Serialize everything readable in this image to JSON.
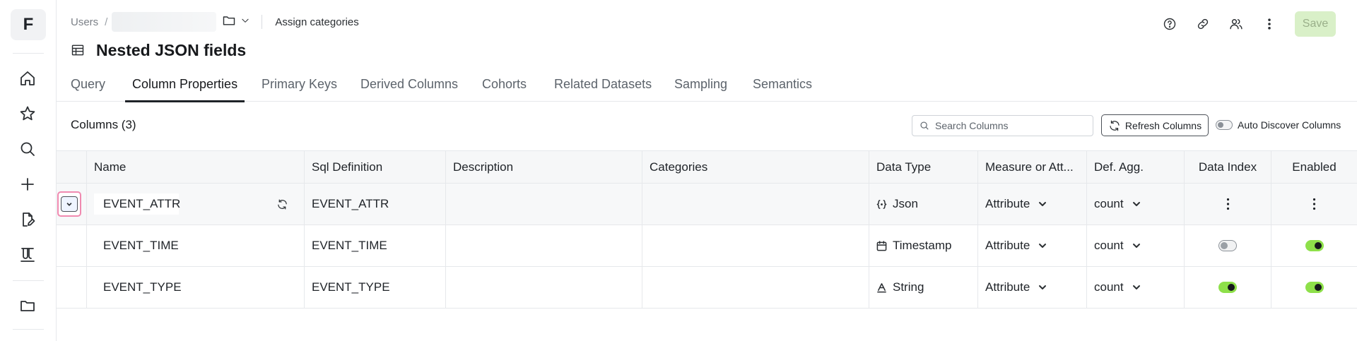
{
  "app": {
    "logo_letter": "F"
  },
  "sidebar": {
    "items": [
      {
        "icon": "home-icon"
      },
      {
        "icon": "star-icon"
      },
      {
        "icon": "search-icon"
      },
      {
        "icon": "plus-icon"
      },
      {
        "icon": "edit-document-icon"
      },
      {
        "icon": "lab-icon"
      },
      {
        "icon": "folder-icon"
      }
    ]
  },
  "breadcrumb": {
    "root": "Users",
    "separator": "/",
    "assign_label": "Assign categories"
  },
  "page": {
    "title": "Nested JSON fields"
  },
  "header": {
    "save_label": "Save"
  },
  "tabs": [
    {
      "label": "Query",
      "active": false
    },
    {
      "label": "Column Properties",
      "active": true
    },
    {
      "label": "Primary Keys",
      "active": false
    },
    {
      "label": "Derived Columns",
      "active": false
    },
    {
      "label": "Cohorts",
      "active": false
    },
    {
      "label": "Related Datasets",
      "active": false
    },
    {
      "label": "Sampling",
      "active": false
    },
    {
      "label": "Semantics",
      "active": false
    }
  ],
  "toolbar": {
    "columns_label": "Columns (3)",
    "search_placeholder": "Search Columns",
    "refresh_label": "Refresh Columns",
    "auto_discover_label": "Auto Discover Columns"
  },
  "table": {
    "headers": {
      "name": "Name",
      "sql": "Sql Definition",
      "description": "Description",
      "categories": "Categories",
      "data_type": "Data Type",
      "measure": "Measure or Att...",
      "def_agg": "Def. Agg.",
      "data_index": "Data Index",
      "enabled": "Enabled"
    },
    "rows": [
      {
        "name": "EVENT_ATTR",
        "sql": "EVENT_ATTR",
        "description": "",
        "categories": "",
        "data_type": "Json",
        "data_type_icon": "json-braces-icon",
        "measure": "Attribute",
        "def_agg": "count",
        "data_index": "menu",
        "enabled": "menu"
      },
      {
        "name": "EVENT_TIME",
        "sql": "EVENT_TIME",
        "description": "",
        "categories": "",
        "data_type": "Timestamp",
        "data_type_icon": "calendar-icon",
        "measure": "Attribute",
        "def_agg": "count",
        "data_index": "off",
        "enabled": "on"
      },
      {
        "name": "EVENT_TYPE",
        "sql": "EVENT_TYPE",
        "description": "",
        "categories": "",
        "data_type": "String",
        "data_type_icon": "text-type-icon",
        "measure": "Attribute",
        "def_agg": "count",
        "data_index": "on",
        "enabled": "on"
      }
    ]
  },
  "colors": {
    "accent_green": "#8ee04a",
    "save_bg": "#d9f0c8",
    "highlight_pink": "#f08ab0"
  }
}
